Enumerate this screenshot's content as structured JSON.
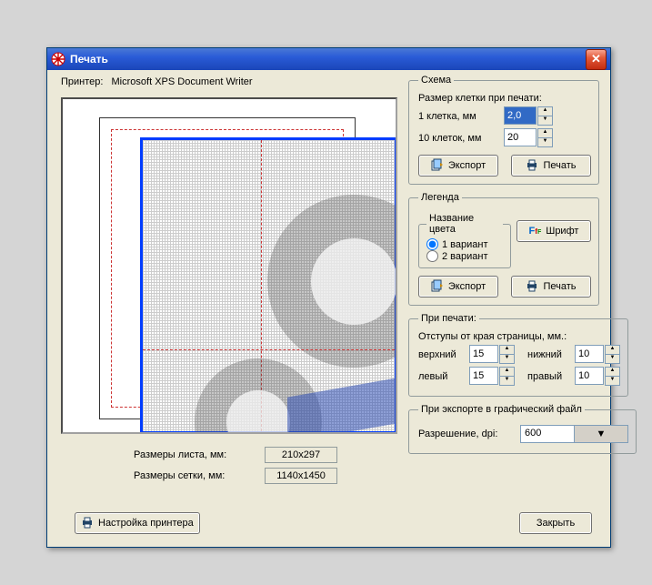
{
  "window": {
    "title": "Печать"
  },
  "printer": {
    "label": "Принтер:",
    "name": "Microsoft XPS Document Writer"
  },
  "scheme": {
    "legend": "Схема",
    "cell_size_label": "Размер клетки при печати:",
    "one_cell_label": "1 клетка, мм",
    "one_cell_value": "2,0",
    "ten_cell_label": "10 клеток, мм",
    "ten_cell_value": "20",
    "export_label": "Экспорт",
    "print_label": "Печать"
  },
  "legend_grp": {
    "legend": "Легенда",
    "color_name_grp": "Название цвета",
    "opt1": "1 вариант",
    "opt2": "2 вариант",
    "font_label": "Шрифт",
    "export_label": "Экспорт",
    "print_label": "Печать"
  },
  "printing": {
    "legend": "При печати:",
    "margins_label": "Отступы от края страницы, мм.:",
    "top_label": "верхний",
    "top_val": "15",
    "bottom_label": "нижний",
    "bottom_val": "10",
    "left_label": "левый",
    "left_val": "15",
    "right_label": "правый",
    "right_val": "10"
  },
  "export_grp": {
    "legend": "При экспорте в графический файл",
    "dpi_label": "Разрешение, dpi:",
    "dpi_value": "600"
  },
  "dims": {
    "sheet_label": "Размеры листа, мм:",
    "sheet_value": "210x297",
    "grid_label": "Размеры сетки, мм:",
    "grid_value": "1140x1450"
  },
  "buttons": {
    "printer_setup": "Настройка принтера",
    "close": "Закрыть"
  }
}
